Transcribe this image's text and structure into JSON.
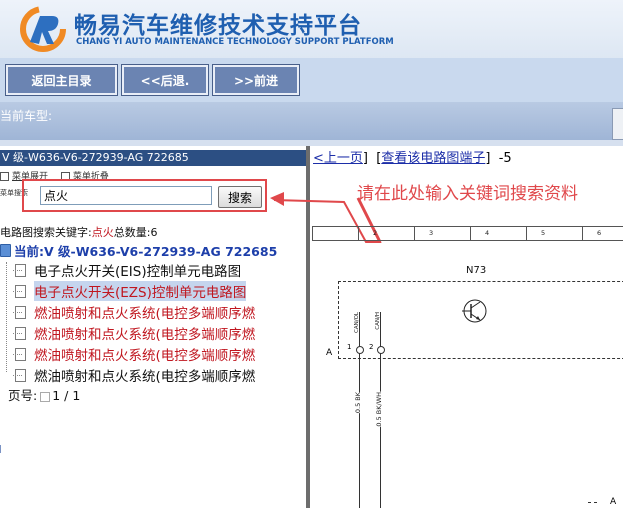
{
  "header": {
    "title": "畅易汽车维修技术支持平台",
    "subtitle": "CHANG YI AUTO MAINTENANCE TECHNOLOGY SUPPORT PLATFORM"
  },
  "toolbar": {
    "home": "返回主目录",
    "back": "<<后退.",
    "forward": ">>前进"
  },
  "vehicle": {
    "label": "当前车型:"
  },
  "left": {
    "header": "V 级-W636-V6-272939-AG 722685",
    "menu_expand": "菜单展开",
    "menu_collapse": "菜单折叠",
    "search_label": "菜单搜索",
    "search_value": "点火",
    "search_button": "搜索",
    "result_prefix": "电路图搜索关键字:",
    "result_keyword": "点火",
    "result_count_label": "总数量:",
    "result_count": "6",
    "current": "当前:V 级-W636-V6-272939-AG 722685",
    "items": [
      {
        "label": "电子点火开关(EIS)控制单元电路图",
        "style": "black"
      },
      {
        "label": "电子点火开关(EZS)控制单元电路图",
        "style": "selected"
      },
      {
        "label": "燃油喷射和点火系统(电控多端顺序燃",
        "style": "red"
      },
      {
        "label": "燃油喷射和点火系统(电控多端顺序燃",
        "style": "red"
      },
      {
        "label": "燃油喷射和点火系统(电控多端顺序燃",
        "style": "red"
      },
      {
        "label": "燃油喷射和点火系统(电控多端顺序燃",
        "style": "black"
      }
    ],
    "pager_label": "页号:",
    "pager_value": "1 / 1"
  },
  "right": {
    "prev_link": "<上一页",
    "terminal_link": "查看该电路图端子",
    "page_suffix": "-5",
    "annotation": "请在此处输入关键词搜索资料",
    "ruler": [
      "",
      "2",
      "3",
      "4",
      "5",
      "6"
    ],
    "component": "N73",
    "marker_a": "A",
    "marker_a2": "A",
    "pin1": "1",
    "pin2": "2",
    "pin1_name": "CAN/OL",
    "pin2_name": "CAN/H",
    "wire1": "0.5 BK",
    "wire2": "0.5 BK/WH"
  },
  "colors": {
    "header_text": "#1f5fb0",
    "toolbar_button": "#6b84b2",
    "panel_header": "#2c4f83",
    "annotation": "#e0484b",
    "highlight_red": "#c0161f"
  }
}
